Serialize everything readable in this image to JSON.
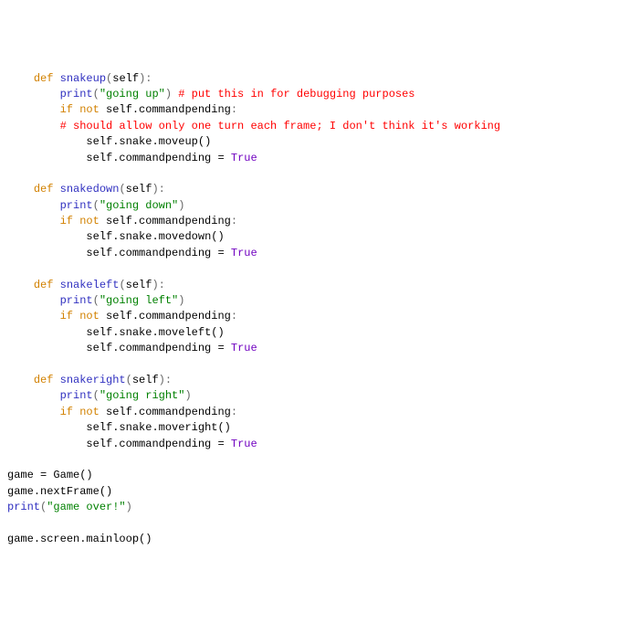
{
  "i1": "    ",
  "i2": "        ",
  "i3": "            ",
  "kw_def": "def",
  "kw_if": "if",
  "kw_not": "not",
  "true_lit": "True",
  "print_name": "print",
  "self": "self",
  "fn_up": "snakeup",
  "fn_down": "snakedown",
  "fn_left": "snakeleft",
  "fn_right": "snakeright",
  "str_up": "\"going up\"",
  "str_down": "\"going down\"",
  "str_left": "\"going left\"",
  "str_right": "\"going right\"",
  "str_over": "\"game over!\"",
  "cmt_debug": "# put this in for debugging purposes",
  "cmt_turn": "# should allow only one turn each frame; I don't think it's working",
  "attr_cp": ".commandpending",
  "attr_snake": ".snake",
  "call_mu": ".moveup()",
  "call_md": ".movedown()",
  "call_ml": ".moveleft()",
  "call_mr": ".moveright()",
  "game_var": "game",
  "game_ctor": "Game()",
  "next_frame": ".nextFrame()",
  "mainloop": ".screen.mainloop()",
  "op_eq": " = ",
  "paren_open": "(",
  "paren_close": ")",
  "sig_tail": "):",
  "colon": ":"
}
